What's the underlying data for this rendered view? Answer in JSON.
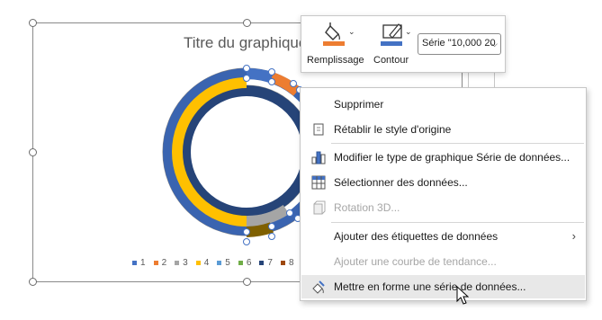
{
  "chart": {
    "title": "Titre du graphique",
    "legend": [
      {
        "label": "1",
        "color": "#4472c4"
      },
      {
        "label": "2",
        "color": "#ed7d31"
      },
      {
        "label": "3",
        "color": "#a5a5a5"
      },
      {
        "label": "4",
        "color": "#ffc000"
      },
      {
        "label": "5",
        "color": "#5b9bd5"
      },
      {
        "label": "6",
        "color": "#70ad47"
      },
      {
        "label": "7",
        "color": "#264478"
      },
      {
        "label": "8",
        "color": "#9e480e"
      }
    ]
  },
  "toolbar": {
    "fill_label": "Remplissage",
    "outline_label": "Contour",
    "fill_color": "#ed7d31",
    "outline_color": "#4472c4",
    "series_value": "Série \"10,000 20"
  },
  "menu": {
    "items": [
      {
        "label": "Supprimer",
        "icon": "delete-icon",
        "enabled": true
      },
      {
        "label": "Rétablir le style d'origine",
        "icon": "reset-style-icon",
        "enabled": true
      },
      {
        "label": "Modifier le type de graphique Série de données...",
        "icon": "chart-type-icon",
        "enabled": true
      },
      {
        "label": "Sélectionner des données...",
        "icon": "select-data-icon",
        "enabled": true
      },
      {
        "label": "Rotation 3D...",
        "icon": "rotation-3d-icon",
        "enabled": false
      },
      {
        "label": "Ajouter des étiquettes de données",
        "icon": "",
        "enabled": true,
        "submenu": true
      },
      {
        "label": "Ajouter une courbe de tendance...",
        "icon": "",
        "enabled": false
      },
      {
        "label": "Mettre en forme une série de données...",
        "icon": "format-series-icon",
        "enabled": true
      }
    ]
  }
}
